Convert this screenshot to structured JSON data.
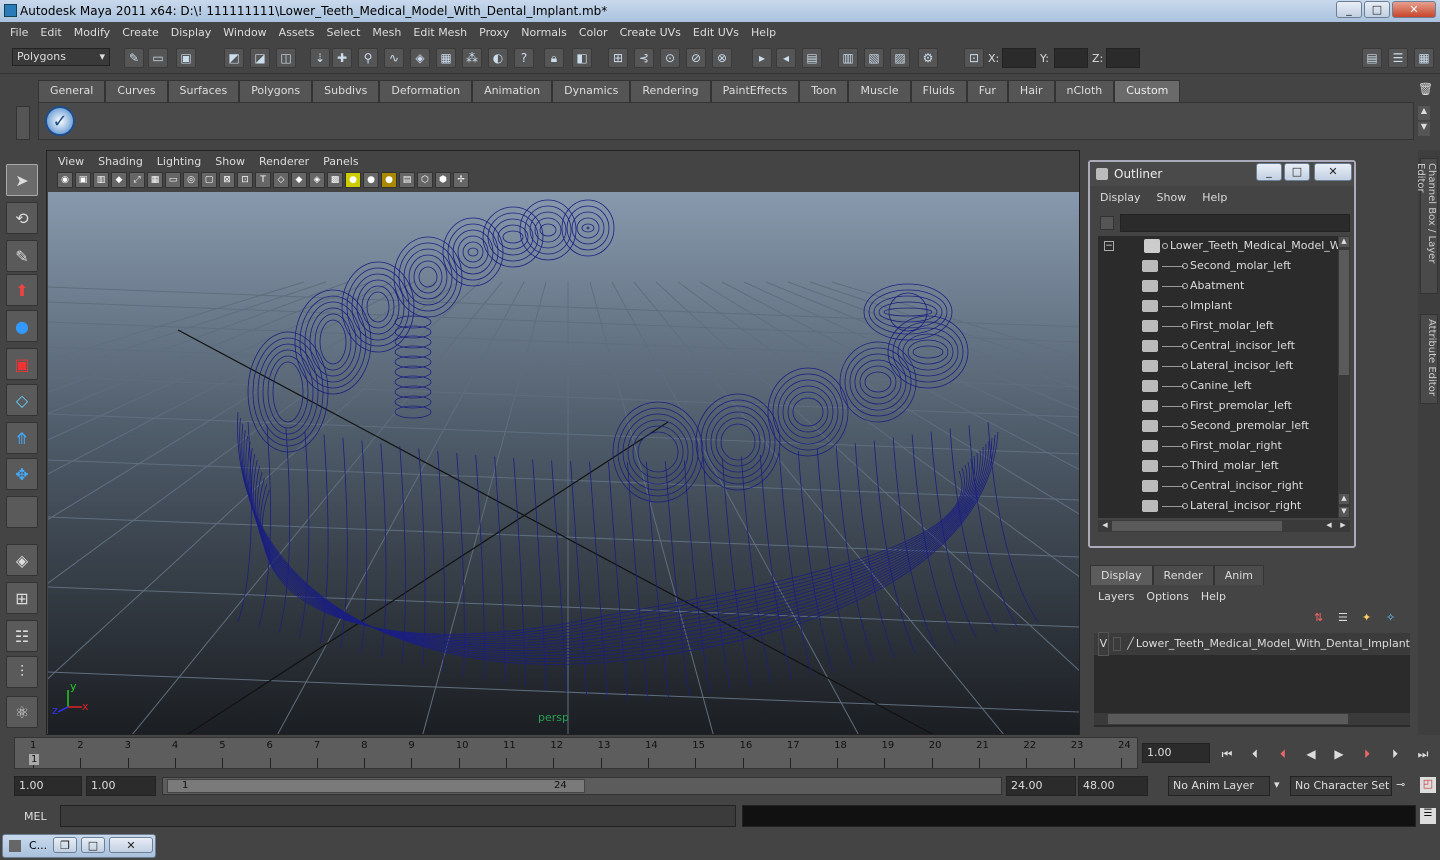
{
  "window": {
    "title": "Autodesk Maya 2011 x64: D:\\! 111111111\\Lower_Teeth_Medical_Model_With_Dental_Implant.mb*"
  },
  "menubar": [
    "File",
    "Edit",
    "Modify",
    "Create",
    "Display",
    "Window",
    "Assets",
    "Select",
    "Mesh",
    "Edit Mesh",
    "Proxy",
    "Normals",
    "Color",
    "Create UVs",
    "Edit UVs",
    "Help"
  ],
  "statusline": {
    "mode": "Polygons",
    "x_label": "X:",
    "y_label": "Y:",
    "z_label": "Z:"
  },
  "shelf_tabs": [
    "General",
    "Curves",
    "Surfaces",
    "Polygons",
    "Subdivs",
    "Deformation",
    "Animation",
    "Dynamics",
    "Rendering",
    "PaintEffects",
    "Toon",
    "Muscle",
    "Fluids",
    "Fur",
    "Hair",
    "nCloth",
    "Custom"
  ],
  "shelf_active": "Custom",
  "viewport": {
    "menu": [
      "View",
      "Shading",
      "Lighting",
      "Show",
      "Renderer",
      "Panels"
    ],
    "camera": "persp",
    "axis_x": "x",
    "axis_y": "y",
    "axis_z": "z"
  },
  "outliner": {
    "title": "Outliner",
    "menu": [
      "Display",
      "Show",
      "Help"
    ],
    "root": "Lower_Teeth_Medical_Model_With",
    "items": [
      "Second_molar_left",
      "Abatment",
      "Implant",
      "First_molar_left",
      "Central_incisor_left",
      "Lateral_incisor_left",
      "Canine_left",
      "First_premolar_left",
      "Second_premolar_left",
      "First_molar_right",
      "Third_molar_left",
      "Central_incisor_right",
      "Lateral_incisor_right"
    ]
  },
  "side_tabs": {
    "channel_box": "Channel Box / Layer Editor",
    "attribute_editor": "Attribute Editor"
  },
  "layer_editor": {
    "tabs": [
      "Display",
      "Render",
      "Anim"
    ],
    "menu": [
      "Layers",
      "Options",
      "Help"
    ],
    "layer": {
      "visible": "V",
      "name": "Lower_Teeth_Medical_Model_With_Dental_Implant"
    }
  },
  "timeline": {
    "start": 1,
    "end": 24,
    "current": "1.00"
  },
  "range": {
    "start": "1.00",
    "start2": "1.00",
    "inner_start": "1",
    "inner_end": "24",
    "end": "24.00",
    "end2": "48.00",
    "anim_layer": "No Anim Layer",
    "char_set": "No Character Set"
  },
  "mel": {
    "label": "MEL"
  },
  "taskbar": {
    "label": "C..."
  }
}
